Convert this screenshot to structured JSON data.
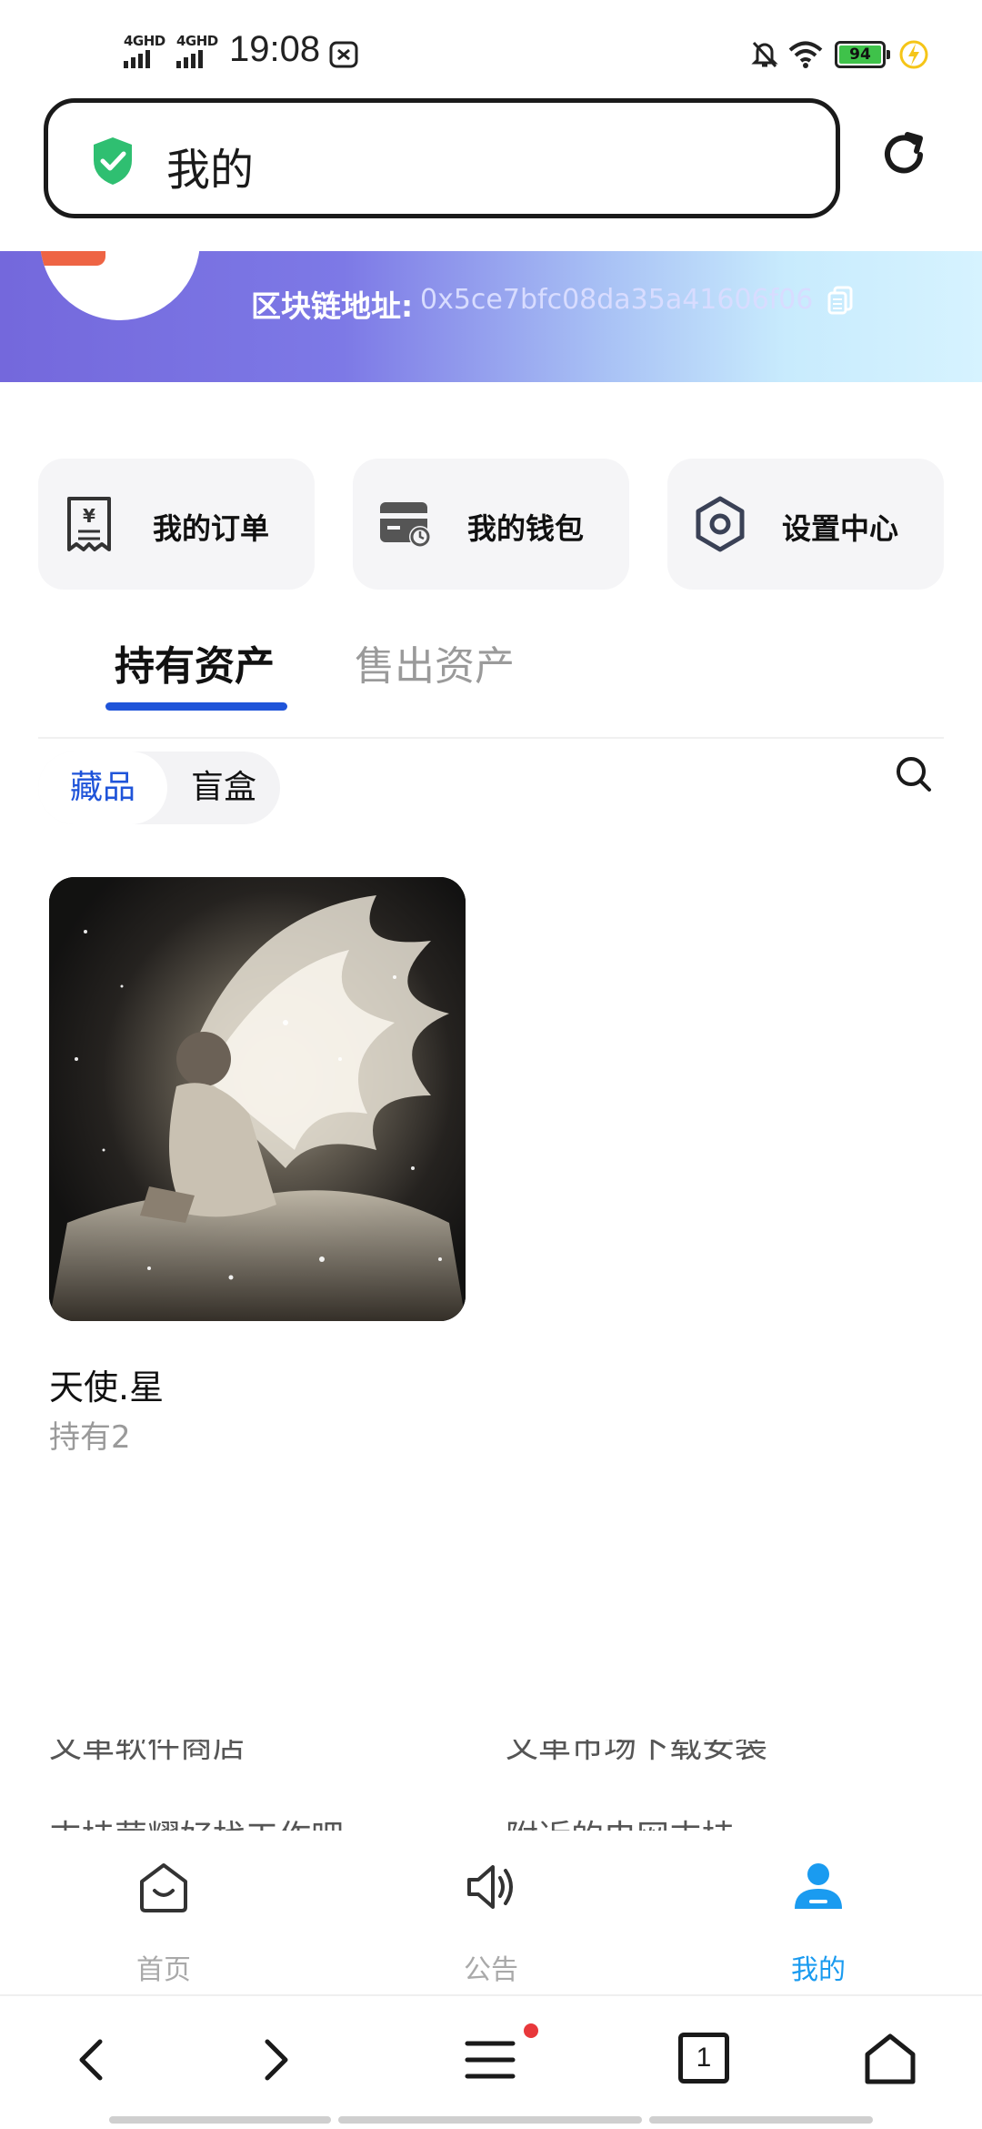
{
  "status_bar": {
    "sim1": "4GHD",
    "sim2": "4GHD",
    "time": "19:08",
    "battery": "94"
  },
  "address_bar": {
    "title": "我的"
  },
  "profile": {
    "chain_label": "区块链地址:",
    "chain_address": "0x5ce7bfc08da35a41606f0668"
  },
  "quick_actions": [
    {
      "label": "我的订单",
      "icon": "receipt-icon"
    },
    {
      "label": "我的钱包",
      "icon": "wallet-icon"
    },
    {
      "label": "设置中心",
      "icon": "settings-hex-icon"
    }
  ],
  "tabs": {
    "held": "持有资产",
    "sold": "售出资产"
  },
  "sub_tabs": {
    "collectibles": "藏品",
    "blind_box": "盲盒"
  },
  "assets": [
    {
      "name": "天使.星",
      "count": "持有2"
    }
  ],
  "ghost_text": {
    "left_1": "文革软件商店",
    "right_1": "文革市场下载安装",
    "left_2": "支持荣耀好找工作吧",
    "right_2": "附近的电网支持"
  },
  "bottom_nav": [
    {
      "label": "首页",
      "icon": "home-smile-icon"
    },
    {
      "label": "公告",
      "icon": "speaker-icon"
    },
    {
      "label": "我的",
      "icon": "user-icon"
    }
  ],
  "browser": {
    "tab_count": "1"
  },
  "colors": {
    "accent_blue": "#1f54d9",
    "nav_active": "#1a9bf0",
    "battery_green": "#3fc24a"
  }
}
